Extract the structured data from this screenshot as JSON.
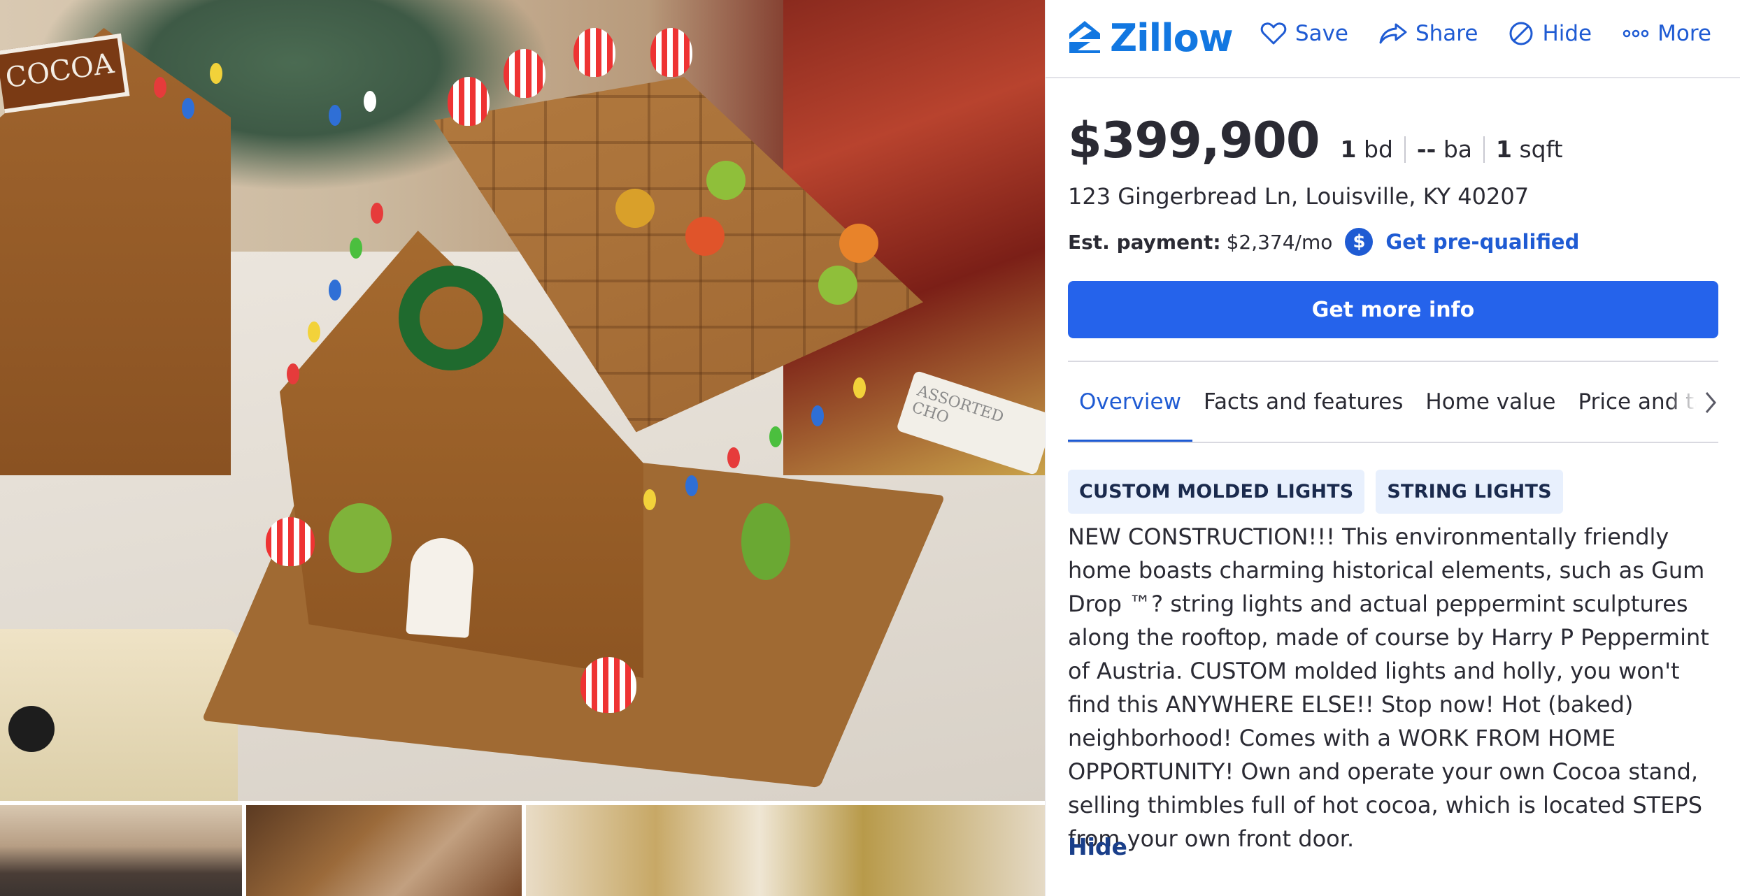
{
  "brand": {
    "name": "Zillow",
    "color": "#1277e1"
  },
  "header_actions": [
    {
      "label": "Save",
      "icon": "heart-icon"
    },
    {
      "label": "Share",
      "icon": "share-icon"
    },
    {
      "label": "Hide",
      "icon": "hide-icon"
    },
    {
      "label": "More",
      "icon": "more-dots-icon"
    }
  ],
  "listing": {
    "price": "$399,900",
    "beds_value": "1",
    "beds_unit": "bd",
    "baths_value": "--",
    "baths_unit": "ba",
    "sqft_value": "1",
    "sqft_unit": "sqft",
    "address": "123 Gingerbread Ln, Louisville, KY 40207",
    "payment_label": "Est. payment:",
    "payment_value": "$2,374/mo",
    "prequal_label": "Get pre-qualified",
    "cta_label": "Get more info"
  },
  "tabs": [
    {
      "label": "Overview",
      "active": true
    },
    {
      "label": "Facts and features",
      "active": false
    },
    {
      "label": "Home value",
      "active": false
    },
    {
      "label": "Price and tax hist",
      "active": false
    }
  ],
  "tags": [
    "CUSTOM MOLDED LIGHTS",
    "STRING LIGHTS"
  ],
  "description": "NEW CONSTRUCTION!!! This environmentally friendly home boasts charming historical elements, such as Gum Drop ™? string lights and actual peppermint sculptures along the rooftop, made of course by Harry P Peppermint of Austria. CUSTOM molded lights and holly, you won't find this ANYWHERE ELSE!! Stop now! Hot (baked) neighborhood! Comes with a WORK FROM HOME OPPORTUNITY! Own and operate your own Cocoa stand, selling thimbles full of hot cocoa, which is located STEPS from your own front door.",
  "hide_label": "Hide",
  "photo_sign_text": "COCOA",
  "photo_box_text": "ASSORTED CHO",
  "colors": {
    "accent": "#1f5bd3",
    "cta": "#2563eb",
    "tag_bg": "#e8f0fd",
    "text": "#2a2a33"
  }
}
